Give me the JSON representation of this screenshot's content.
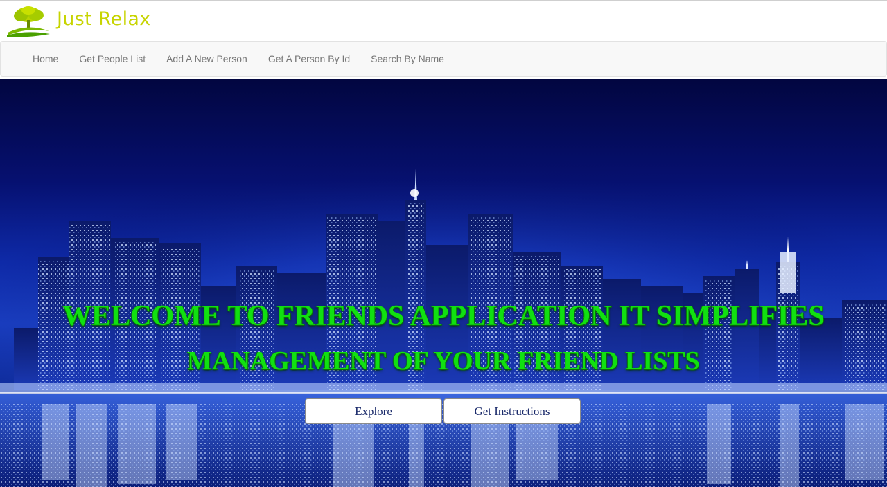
{
  "brand": {
    "name": "Just Relax",
    "logo_icon": "tree-icon",
    "color": "#c7d400"
  },
  "nav": {
    "items": [
      {
        "label": "Home"
      },
      {
        "label": "Get People List"
      },
      {
        "label": "Add A New Person"
      },
      {
        "label": "Get A Person By Id"
      },
      {
        "label": "Search By Name"
      }
    ]
  },
  "hero": {
    "headline_line1": "WELCOME TO FRIENDS APPLICATION IT SIMPLIFIES",
    "headline_line2": "MANAGEMENT OF YOUR FRIEND LISTS",
    "headline_color": "#11e011",
    "background": "night-city-skyline-image",
    "buttons": {
      "explore": "Explore",
      "instructions": "Get Instructions"
    }
  }
}
